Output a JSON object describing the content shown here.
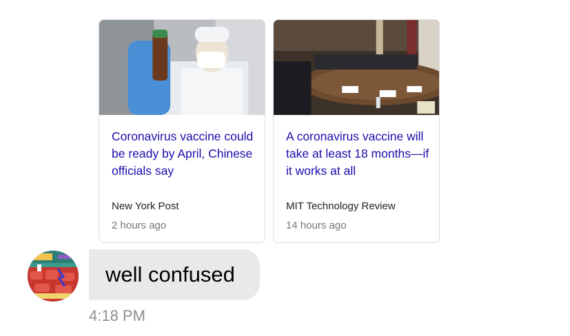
{
  "cards": [
    {
      "image_alt": "Scientist in lab coat and mask holding a vial",
      "title": "Coronavirus vaccine could be ready by April, Chinese officials say",
      "source": "New York Post",
      "time": "2 hours ago"
    },
    {
      "image_alt": "Officials seated around a conference table",
      "title": "A coronavirus vaccine will take at least 18 months—if it works at all",
      "source": "MIT Technology Review",
      "time": "14 hours ago"
    }
  ],
  "message": {
    "text": "well confused",
    "timestamp": "4:18 PM",
    "bubble_color": "#e9e9eb"
  },
  "colors": {
    "link": "#1a0dab",
    "source": "#202124",
    "meta": "#70757a",
    "timestamp": "#8e8e93"
  }
}
